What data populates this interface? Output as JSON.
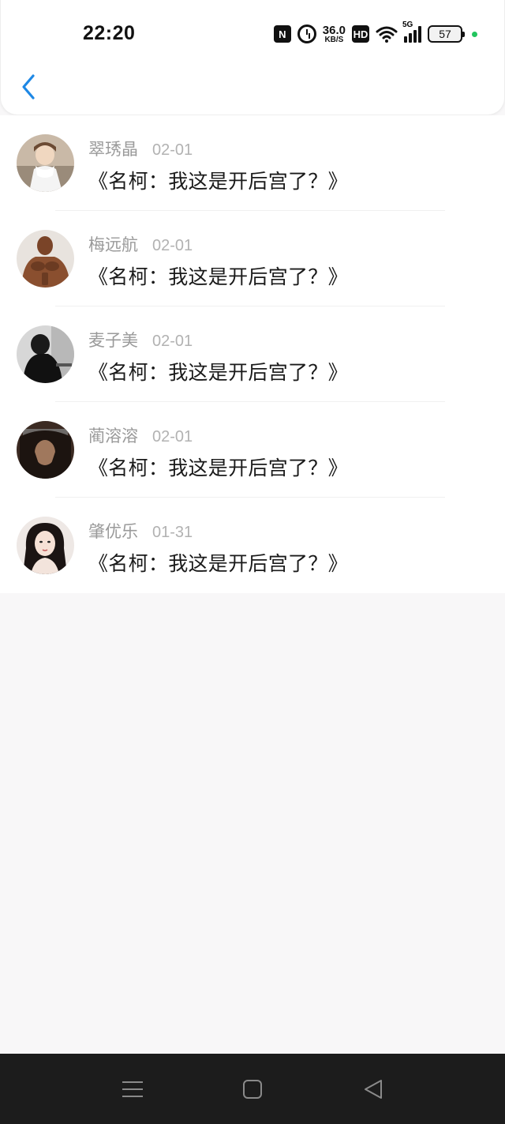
{
  "status_bar": {
    "time": "22:20",
    "nfc_label": "N",
    "speed_value": "36.0",
    "speed_unit": "KB/S",
    "hd_label": "HD",
    "network_label": "5G",
    "battery_level": "57",
    "battery_percent": 57,
    "indicator_color": "#22c55e"
  },
  "header": {
    "back_icon": "chevron-left-icon",
    "accent_color": "#1e88e5"
  },
  "comments": [
    {
      "name": "翠琇晶",
      "date": "02-01",
      "message": "《名柯：我这是开后宫了？》",
      "avatar": "avatar-girl-scarf"
    },
    {
      "name": "梅远航",
      "date": "02-01",
      "message": "《名柯：我这是开后宫了？》",
      "avatar": "avatar-muscle-man"
    },
    {
      "name": "麦子美",
      "date": "02-01",
      "message": "《名柯：我这是开后宫了？》",
      "avatar": "avatar-dark-figure"
    },
    {
      "name": "蔺溶溶",
      "date": "02-01",
      "message": "《名柯：我这是开后宫了？》",
      "avatar": "avatar-anime-ninja"
    },
    {
      "name": "肇优乐",
      "date": "01-31",
      "message": "《名柯：我这是开后宫了？》",
      "avatar": "avatar-woman-portrait"
    }
  ],
  "nav_bar": {
    "menu_icon": "menu-icon",
    "home_icon": "home-square-icon",
    "back_icon": "back-triangle-icon"
  }
}
